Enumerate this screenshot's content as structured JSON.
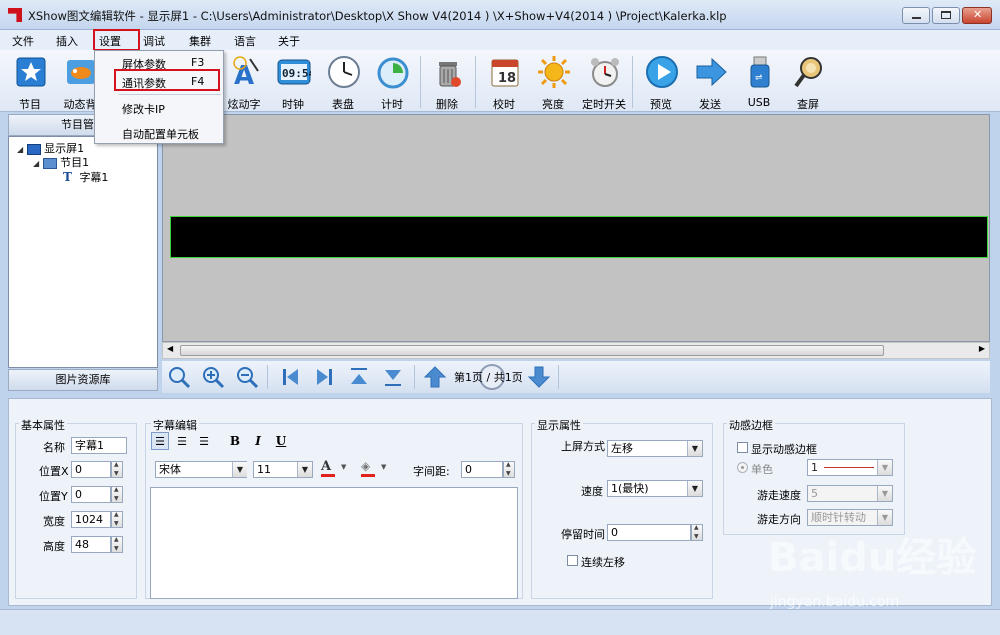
{
  "window": {
    "title": "XShow图文编辑软件 - 显示屏1 - C:\\Users\\Administrator\\Desktop\\X Show V4(2014 ) \\X+Show+V4(2014 ) \\Project\\Kalerka.klp"
  },
  "menu": [
    "文件",
    "插入",
    "设置",
    "调试",
    "集群",
    "语言",
    "关于"
  ],
  "settings_menu": {
    "items": [
      {
        "label": "屏体参数",
        "shortcut": "F3"
      },
      {
        "label": "通讯参数",
        "shortcut": "F4"
      },
      {
        "label": "修改卡IP",
        "shortcut": ""
      },
      {
        "label": "自动配置单元板",
        "shortcut": ""
      }
    ]
  },
  "toolbar": [
    {
      "label": "节目",
      "icon": "program-icon"
    },
    {
      "label": "动态背",
      "icon": "dynamic-background-icon"
    },
    {
      "label": "炫动字",
      "icon": "animated-text-icon"
    },
    {
      "label": "时钟",
      "icon": "digital-clock-icon"
    },
    {
      "label": "表盘",
      "icon": "analog-clock-icon"
    },
    {
      "label": "计时",
      "icon": "timer-icon"
    },
    {
      "label": "删除",
      "icon": "trash-icon"
    },
    {
      "label": "校时",
      "icon": "calendar-icon"
    },
    {
      "label": "亮度",
      "icon": "sun-icon"
    },
    {
      "label": "定时开关",
      "icon": "alarm-clock-icon"
    },
    {
      "label": "预览",
      "icon": "play-icon"
    },
    {
      "label": "发送",
      "icon": "send-arrow-icon"
    },
    {
      "label": "USB",
      "icon": "usb-icon"
    },
    {
      "label": "查屏",
      "icon": "magnifier-icon"
    }
  ],
  "left_panel": {
    "tab_program": "节目管理",
    "tab_images": "图片资源库",
    "tree": [
      {
        "label": "显示屏1",
        "level": 0
      },
      {
        "label": "节目1",
        "level": 1
      },
      {
        "label": "字幕1",
        "level": 2
      }
    ]
  },
  "nav": {
    "page_text": "第1页 / 共1页"
  },
  "basic": {
    "title": "基本属性",
    "name_label": "名称",
    "name": "字幕1",
    "x_label": "位置X",
    "x": "0",
    "y_label": "位置Y",
    "y": "0",
    "w_label": "宽度",
    "w": "1024",
    "h_label": "高度",
    "h": "48"
  },
  "editor": {
    "title": "字幕编辑",
    "font": "宋体",
    "size": "11",
    "spacing_label": "字间距:",
    "spacing": "0",
    "bold": "B",
    "italic": "I",
    "underline": "U"
  },
  "display": {
    "title": "显示属性",
    "mode_label": "上屏方式",
    "mode": "左移",
    "speed_label": "速度",
    "speed": "1(最快)",
    "stay_label": "停留时间",
    "stay": "0",
    "continuous_label": "连续左移"
  },
  "border": {
    "title": "动感边框",
    "show_label": "显示动感边框",
    "single_label": "单色",
    "single_value": "1",
    "speed_label": "游走速度",
    "speed": "5",
    "dir_label": "游走方向",
    "dir": "顺时针转动"
  },
  "watermark": {
    "brand": "Baidu经验",
    "url": "jingyan.baidu.com"
  },
  "colors": {
    "accent_red": "#d3121e",
    "led_border": "#3bd43b",
    "canvas": "#c2c2c2"
  }
}
